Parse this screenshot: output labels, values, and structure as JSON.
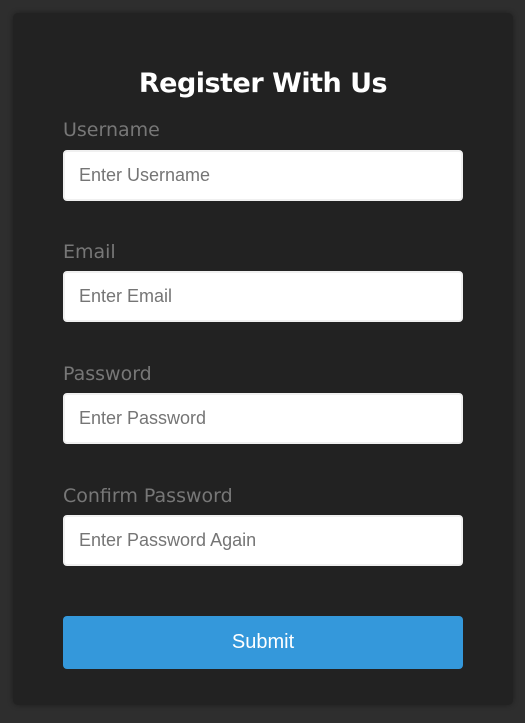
{
  "form": {
    "title": "Register With Us",
    "fields": [
      {
        "label": "Username",
        "placeholder": "Enter Username",
        "value": ""
      },
      {
        "label": "Email",
        "placeholder": "Enter Email",
        "value": ""
      },
      {
        "label": "Password",
        "placeholder": "Enter Password",
        "value": ""
      },
      {
        "label": "Confirm Password",
        "placeholder": "Enter Password Again",
        "value": ""
      }
    ],
    "submit_label": "Submit"
  },
  "colors": {
    "background": "#2e2e2e",
    "card": "#222222",
    "label": "#777777",
    "button": "#3498db"
  }
}
